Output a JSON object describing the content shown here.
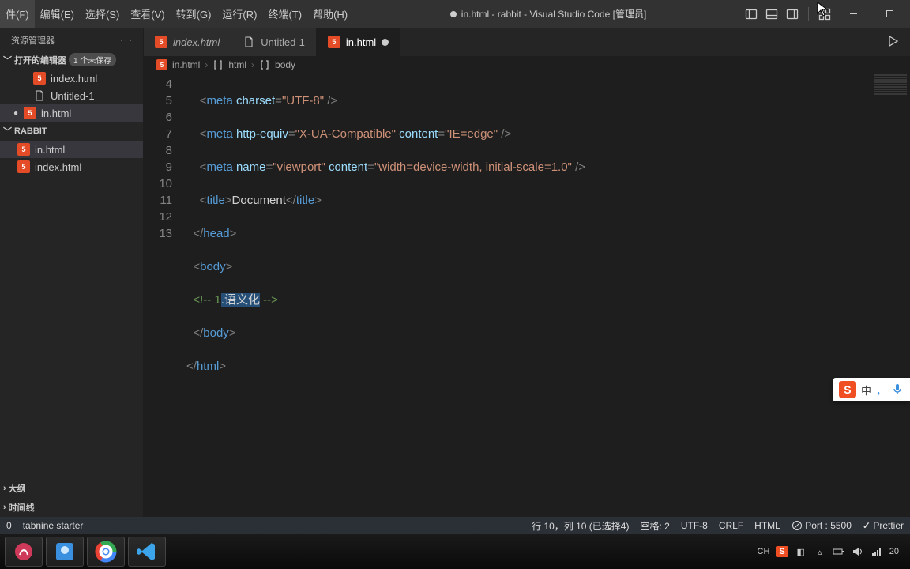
{
  "menu": {
    "file": "件(F)",
    "edit": "编辑(E)",
    "select": "选择(S)",
    "view": "查看(V)",
    "goto": "转到(G)",
    "run": "运行(R)",
    "terminal": "终端(T)",
    "help": "帮助(H)"
  },
  "title": "in.html - rabbit - Visual Studio Code [管理员]",
  "sidebar": {
    "header": "资源管理器",
    "open_editors": "打开的编辑器",
    "badge": "1 个未保存",
    "items": [
      {
        "name": "index.html",
        "type": "html"
      },
      {
        "name": "Untitled-1",
        "type": "txt"
      },
      {
        "name": "in.html",
        "type": "html",
        "dirty": true,
        "active": true
      }
    ],
    "folder": "RABBIT",
    "folder_items": [
      {
        "name": "in.html",
        "type": "html",
        "active": true
      },
      {
        "name": "index.html",
        "type": "html"
      }
    ],
    "outline": "大纲",
    "timeline": "时间线"
  },
  "tabs": [
    {
      "name": "index.html",
      "type": "html",
      "italic": true
    },
    {
      "name": "Untitled-1",
      "type": "txt"
    },
    {
      "name": "in.html",
      "type": "html",
      "active": true,
      "dirty": true
    }
  ],
  "breadcrumb": {
    "file": "in.html",
    "n1": "html",
    "n2": "body"
  },
  "code": {
    "lines": [
      "4",
      "5",
      "6",
      "7",
      "8",
      "9",
      "10",
      "11",
      "12",
      "13"
    ],
    "l4_meta": "meta",
    "l4_charset": "charset",
    "l4_utf": "\"UTF-8\"",
    "l5_http": "http-equiv",
    "l5_xua": "\"X-UA-Compatible\"",
    "l5_content": "content",
    "l5_ie": "\"IE=edge\"",
    "l6_name": "name",
    "l6_vp": "\"viewport\"",
    "l6_c": "\"width=device-width, initial-scale=1.0\"",
    "l7_title": "title",
    "l7_doc": "Document",
    "l8_head": "head",
    "l9_body": "body",
    "l10_pre": "<!-- 1",
    "l10_sel": ".语义化",
    "l10_post": " -->",
    "l11_body": "body",
    "l12_html": "html"
  },
  "status": {
    "left0": "0",
    "left1": "tabnine starter",
    "pos": "行 10，列 10 (已选择4)",
    "spaces": "空格: 2",
    "enc": "UTF-8",
    "eol": "CRLF",
    "lang": "HTML",
    "port": "Port : 5500",
    "prettier": "Prettier"
  },
  "ime": {
    "s": "S",
    "zhong": "中",
    "comma": "，"
  },
  "tray": {
    "ch": "CH",
    "s": "S",
    "time": "20"
  }
}
